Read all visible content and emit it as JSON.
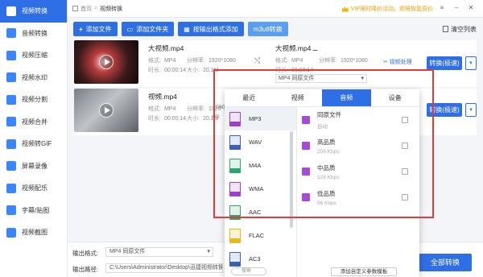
{
  "sidebar": {
    "items": [
      {
        "label": "视频转换",
        "icon": "video-convert-icon",
        "active": true
      },
      {
        "label": "音频转换",
        "icon": "audio-convert-icon"
      },
      {
        "label": "视频压缩",
        "icon": "video-compress-icon"
      },
      {
        "label": "视频水印",
        "icon": "watermark-icon"
      },
      {
        "label": "视频分割",
        "icon": "split-icon"
      },
      {
        "label": "视频合并",
        "icon": "merge-icon"
      },
      {
        "label": "视频转GIF",
        "icon": "gif-icon"
      },
      {
        "label": "屏幕录像",
        "icon": "screen-record-icon"
      },
      {
        "label": "视频配乐",
        "icon": "music-icon"
      },
      {
        "label": "字幕/贴图",
        "icon": "subtitle-icon"
      },
      {
        "label": "视频截图",
        "icon": "screenshot-icon"
      }
    ]
  },
  "topbar": {
    "home": "首页",
    "current": "视频转换",
    "vip_text": "VIP限时降价活动，即将恢复原价"
  },
  "toolbar": {
    "add_file": "添加文件",
    "add_folder": "添加文件夹",
    "add_by_format": "按输出格式添加",
    "m3u8": "m3u8转换",
    "clear": "清空列表"
  },
  "files": [
    {
      "name": "大视频.mp4",
      "format_label": "格式:",
      "format": "MP4",
      "res_label": "分辨率:",
      "res": "1920*1080",
      "dur_label": "时长:",
      "dur": "00:00:14",
      "size_label": "大小:",
      "size": "20.1M",
      "out_name": "大视频.mp4",
      "out_format": "MP4",
      "out_res": "1920*1080",
      "out_dur": "00:00:14",
      "out_select": "MP4  同原文件",
      "process": "视频处理",
      "convert": "转换(极速)"
    },
    {
      "name": "视频.mp4",
      "format_label": "格式:",
      "format": "MP4",
      "res_label": "分辨率:",
      "res": "1920*1080",
      "dur_label": "时长:",
      "dur": "00:00:14",
      "size_label": "大小:",
      "size": "20.1M",
      "out_name": "",
      "out_res": "1080",
      "out_dur": "00:",
      "convert": "转换(极速)"
    }
  ],
  "bottom": {
    "out_format_label": "输出格式:",
    "out_format": "MP4  同原文件",
    "out_path_label": "输出路径:",
    "out_path": "C:\\Users\\Administrator\\Desktop\\迅捷视频转换",
    "convert_all": "全部转换"
  },
  "popup": {
    "tabs": [
      "最近",
      "视频",
      "音频",
      "设备"
    ],
    "active_tab": 2,
    "formats": [
      {
        "label": "MP3",
        "color": "#9c3fd0"
      },
      {
        "label": "WAV",
        "color": "#3b5fb8"
      },
      {
        "label": "M4A",
        "color": "#2ea56b"
      },
      {
        "label": "WMA",
        "color": "#9c3fd0"
      },
      {
        "label": "AAC",
        "color": "#2ea56b"
      },
      {
        "label": "FLAC",
        "color": "#e8b820"
      },
      {
        "label": "AC3",
        "color": "#3b5fb8"
      }
    ],
    "qualities": [
      {
        "name": "同原文件",
        "sub": "自动"
      },
      {
        "name": "高品质",
        "sub": "256 Kbps"
      },
      {
        "name": "中品质",
        "sub": "128 Kbps"
      },
      {
        "name": "低品质",
        "sub": "96 Kbps"
      }
    ],
    "search_placeholder": "搜索",
    "custom": "添加自定义参数模板"
  },
  "colors": {
    "accent": "#2f6fe6",
    "highlight": "#e33a3a"
  }
}
